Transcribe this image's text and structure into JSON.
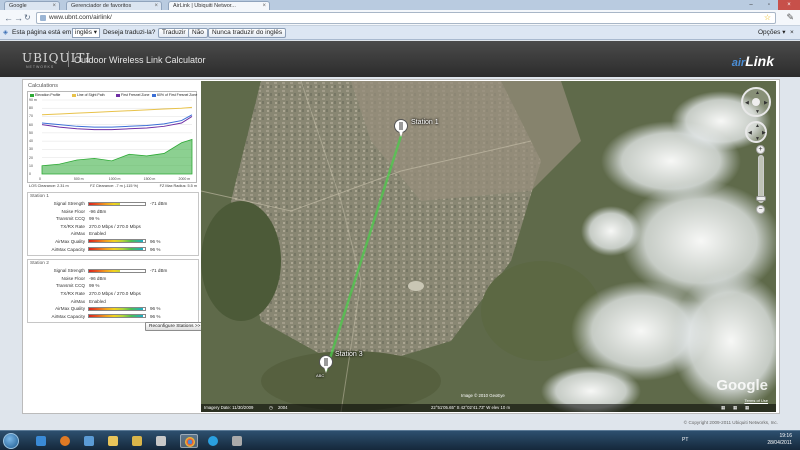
{
  "browser": {
    "tabs": [
      {
        "label": "Google",
        "active": false
      },
      {
        "label": "Gerenciador de favoritos",
        "active": false
      },
      {
        "label": "AirLink | Ubiquiti Networ...",
        "active": true
      }
    ],
    "url": "www.ubnt.com/airlink/",
    "translate_bar": {
      "prefix": "Esta página está em",
      "language": "inglês",
      "question": "Deseja traduzi-la?",
      "translate_btn": "Traduzir",
      "no_btn": "Não",
      "never_btn": "Nunca traduzir do inglês",
      "options": "Opções"
    }
  },
  "app": {
    "logo": "UBIQUITI",
    "logo_sub": "NETWORKS",
    "title": "Outdoor Wireless Link Calculator",
    "brand": "Link",
    "brand_prefix": "air"
  },
  "calc": {
    "section_title": "Calculations",
    "legend": [
      {
        "label": "Elevation Profile",
        "color": "#2eaa36"
      },
      {
        "label": "Line of Sight Path",
        "color": "#e8c24a"
      },
      {
        "label": "First Fresnel Zone",
        "color": "#6f2fa4"
      },
      {
        "label": "60% of First Fresnel Zone",
        "color": "#3b6fd6"
      }
    ],
    "stats": {
      "los": "LOS Clearance: 2.31 m",
      "fz": "FZ Clearance: -7 m (-115 %)",
      "fzmax": "FZ Max Radius: 5.5 m"
    }
  },
  "chart_data": {
    "type": "area",
    "title": "",
    "xlabel": "",
    "ylabel": "",
    "x": [
      0,
      250,
      500,
      750,
      1000,
      1250,
      1500,
      1750,
      2000,
      2150
    ],
    "xticks": [
      "0",
      "500 m",
      "1000 m",
      "1500 m",
      "2000 m"
    ],
    "yticks": [
      "90",
      "80",
      "70",
      "60",
      "50",
      "40",
      "30",
      "20",
      "10",
      "0"
    ],
    "ylim": [
      0,
      90
    ],
    "series": [
      {
        "name": "Elevation Profile",
        "values": [
          10,
          12,
          17,
          19,
          16,
          24,
          22,
          25,
          38,
          42
        ]
      },
      {
        "name": "Line of Sight Path",
        "values": [
          72,
          73,
          74,
          75,
          76,
          77,
          78,
          79,
          80,
          81
        ]
      },
      {
        "name": "First Fresnel Zone",
        "values": [
          60,
          57,
          55,
          54,
          54,
          55,
          56,
          58,
          62,
          70
        ]
      },
      {
        "name": "60% of First Fresnel Zone",
        "values": [
          62,
          60,
          58,
          57,
          57,
          58,
          59,
          61,
          65,
          72
        ]
      }
    ],
    "grid": true,
    "legend_placement": "top"
  },
  "stations": [
    {
      "title": "Station 1",
      "rows": [
        {
          "label": "Signal Strength",
          "type": "meter",
          "level": 0.55,
          "value": "-71 dBm"
        },
        {
          "label": "Noise Floor",
          "type": "text",
          "value": "-96 dBm"
        },
        {
          "label": "Transmit CCQ",
          "type": "text",
          "value": "99 %"
        },
        {
          "label": "TX/RX Rate",
          "type": "text",
          "value": "270.0 Mbps / 270.0 Mbps"
        },
        {
          "label": "AirMax",
          "type": "text",
          "value": "Enabled"
        },
        {
          "label": "AirMax Quality",
          "type": "meter",
          "level": 0.96,
          "value": "96 %"
        },
        {
          "label": "AirMax Capacity",
          "type": "meter",
          "level": 0.96,
          "value": "96 %"
        }
      ]
    },
    {
      "title": "Station 2",
      "rows": [
        {
          "label": "Signal Strength",
          "type": "meter",
          "level": 0.55,
          "value": "-71 dBm"
        },
        {
          "label": "Noise Floor",
          "type": "text",
          "value": "-96 dBm"
        },
        {
          "label": "Transmit CCQ",
          "type": "text",
          "value": "99 %"
        },
        {
          "label": "TX/RX Rate",
          "type": "text",
          "value": "270.0 Mbps / 270.0 Mbps"
        },
        {
          "label": "AirMax",
          "type": "text",
          "value": "Enabled"
        },
        {
          "label": "AirMax Quality",
          "type": "meter",
          "level": 0.96,
          "value": "96 %"
        },
        {
          "label": "AirMax Capacity",
          "type": "meter",
          "level": 0.96,
          "value": "96 %"
        }
      ]
    }
  ],
  "reconfigure_btn": "Reconfigure Stations >>",
  "map": {
    "station_a": "Station 1",
    "station_b": "Station 3",
    "station_b_sub": "ABC",
    "image_credit": "Image © 2010 GeoEye",
    "status_date": "Imagery Date: 11/30/2009",
    "status_year": "2004",
    "status_coords": "22°51'05.65\" S  42°02'41.73\" W  elev  10 m",
    "google": "Google",
    "terms": "Terms of Use"
  },
  "footer": {
    "copyright": "© Copyright 2009-2011 Ubiquiti Networks, Inc."
  },
  "taskbar": {
    "lang": "PT",
    "time": "19:16",
    "date": "28/04/2011"
  }
}
